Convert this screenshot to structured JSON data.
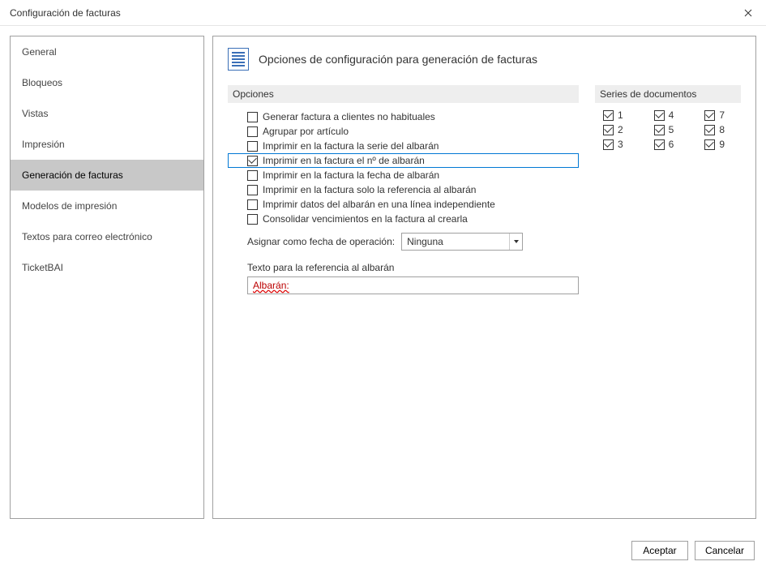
{
  "window": {
    "title": "Configuración de facturas"
  },
  "sidebar": {
    "items": [
      {
        "label": "General"
      },
      {
        "label": "Bloqueos"
      },
      {
        "label": "Vistas"
      },
      {
        "label": "Impresión"
      },
      {
        "label": "Generación de facturas",
        "selected": true
      },
      {
        "label": "Modelos de impresión"
      },
      {
        "label": "Textos para correo electrónico"
      },
      {
        "label": "TicketBAI"
      }
    ]
  },
  "main": {
    "heading": "Opciones de configuración para generación de facturas",
    "opciones_header": "Opciones",
    "series_header": "Series de documentos",
    "checkboxes": [
      {
        "label": "Generar factura a clientes no habituales",
        "checked": false
      },
      {
        "label": "Agrupar por artículo",
        "checked": false
      },
      {
        "label": "Imprimir en la factura la serie del albarán",
        "checked": false
      },
      {
        "label": "Imprimir en la factura el nº de albarán",
        "checked": true,
        "highlighted": true
      },
      {
        "label": "Imprimir en la factura la fecha de albarán",
        "checked": false
      },
      {
        "label": "Imprimir en la factura solo la referencia al albarán",
        "checked": false
      },
      {
        "label": "Imprimir datos del albarán en una línea independiente",
        "checked": false
      },
      {
        "label": "Consolidar vencimientos en la factura al crearla",
        "checked": false
      }
    ],
    "assign_label": "Asignar como fecha de operación:",
    "assign_value": "Ninguna",
    "ref_label": "Texto para la referencia al albarán",
    "ref_value": "Albarán:",
    "series": [
      {
        "label": "1",
        "checked": true
      },
      {
        "label": "4",
        "checked": true
      },
      {
        "label": "7",
        "checked": true
      },
      {
        "label": "2",
        "checked": true
      },
      {
        "label": "5",
        "checked": true
      },
      {
        "label": "8",
        "checked": true
      },
      {
        "label": "3",
        "checked": true
      },
      {
        "label": "6",
        "checked": true
      },
      {
        "label": "9",
        "checked": true
      }
    ]
  },
  "footer": {
    "accept": "Aceptar",
    "cancel": "Cancelar"
  }
}
